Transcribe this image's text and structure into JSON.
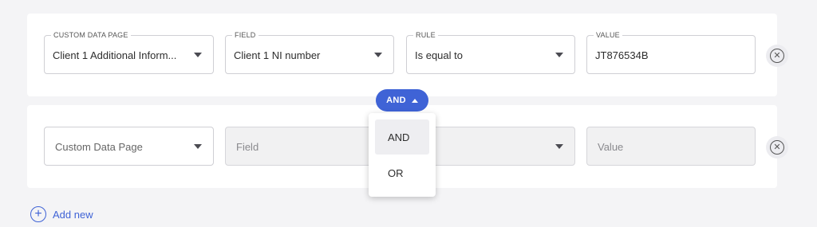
{
  "conditions": [
    {
      "custom_data_page": {
        "legend": "CUSTOM DATA PAGE",
        "value": "Client 1 Additional Inform..."
      },
      "field": {
        "legend": "FIELD",
        "value": "Client 1 NI number"
      },
      "rule": {
        "legend": "RULE",
        "value": "Is equal to"
      },
      "value": {
        "legend": "VALUE",
        "value": "JT876534B"
      },
      "remove_icon": "close-circle-icon"
    },
    {
      "custom_data_page": {
        "placeholder": "Custom Data Page"
      },
      "field": {
        "placeholder": "Field"
      },
      "rule": {
        "placeholder_visible_fragment": "e"
      },
      "value": {
        "placeholder": "Value"
      },
      "remove_icon": "close-circle-icon"
    }
  ],
  "operator": {
    "selected": "AND",
    "options": [
      "AND",
      "OR"
    ]
  },
  "add_new": {
    "label": "Add new",
    "icon": "plus-circle-icon"
  },
  "colors": {
    "accent": "#3f63d6",
    "background": "#f4f4f6",
    "card": "#ffffff"
  }
}
